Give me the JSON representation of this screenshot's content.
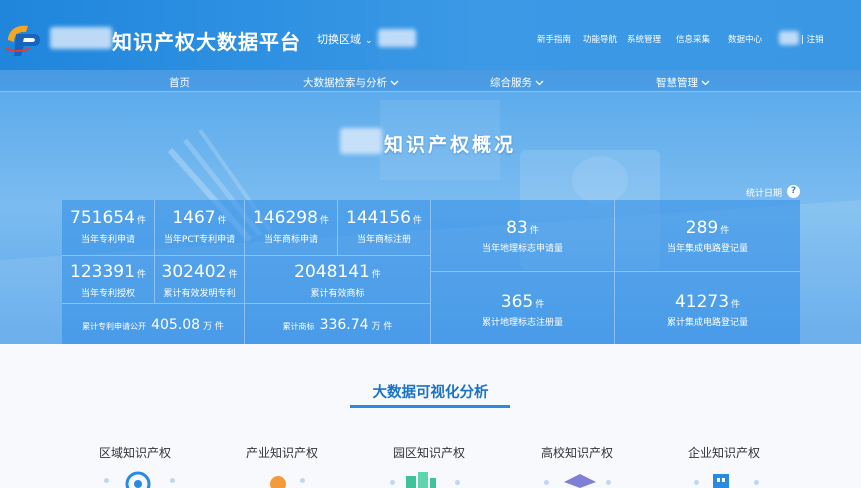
{
  "header": {
    "site_title": "知识产权大数据平台",
    "region_label": "切换区域",
    "nav_links": [
      "新手指南",
      "功能导航",
      "系统管理",
      "信息采集",
      "数据中心"
    ],
    "logout_label": "| 注销"
  },
  "main_nav": [
    {
      "label": "首页",
      "has_dropdown": false
    },
    {
      "label": "大数据检索与分析",
      "has_dropdown": true
    },
    {
      "label": "综合服务",
      "has_dropdown": true
    },
    {
      "label": "智慧管理",
      "has_dropdown": true
    }
  ],
  "overview": {
    "title": "知识产权概况",
    "date_label": "统计日期",
    "unit": "件",
    "unit_wan": "万 件",
    "stats": {
      "patent_apply": {
        "value": "751654",
        "label": "当年专利申请"
      },
      "pct_apply": {
        "value": "1467",
        "label": "当年PCT专利申请"
      },
      "tm_apply": {
        "value": "146298",
        "label": "当年商标申请"
      },
      "tm_register": {
        "value": "144156",
        "label": "当年商标注册"
      },
      "patent_grant": {
        "value": "123391",
        "label": "当年专利授权"
      },
      "valid_invention": {
        "value": "302402",
        "label": "累计有效发明专利"
      },
      "valid_tm": {
        "value": "2048141",
        "label": "累计有效商标"
      },
      "patent_public_total": {
        "value": "405.08",
        "label": "累计专利申请公开"
      },
      "tm_total": {
        "value": "336.74",
        "label": "累计商标"
      },
      "geo_apply": {
        "value": "83",
        "label": "当年地理标志申请量"
      },
      "ic_register": {
        "value": "289",
        "label": "当年集成电路登记量"
      },
      "geo_total": {
        "value": "365",
        "label": "累计地理标志注册量"
      },
      "ic_total": {
        "value": "41273",
        "label": "累计集成电路登记量"
      }
    }
  },
  "visualization": {
    "title": "大数据可视化分析",
    "categories": [
      "区域知识产权",
      "产业知识产权",
      "园区知识产权",
      "高校知识产权",
      "企业知识产权"
    ]
  },
  "colors": {
    "primary": "#2a8ae0",
    "header": "#1f86dc",
    "accent_orange": "#f39a3b",
    "accent_green": "#3fc49a"
  }
}
